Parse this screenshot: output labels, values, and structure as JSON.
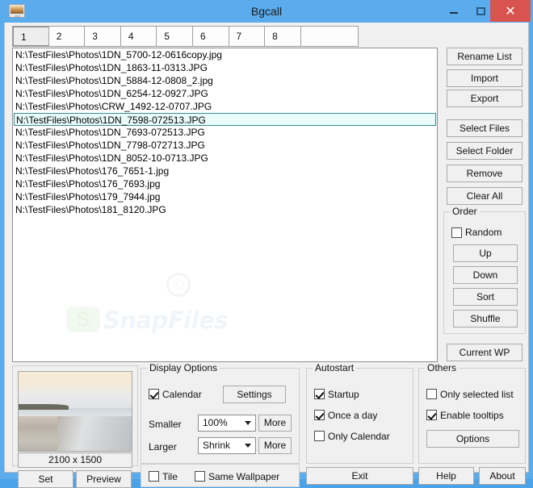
{
  "window": {
    "title": "Bgcall",
    "icon": "monitor-wallpaper-icon",
    "minimize_label": "—",
    "maximize_label": "□",
    "close_label": "✕"
  },
  "tabs": {
    "items": [
      "1",
      "2",
      "3",
      "4",
      "5",
      "6",
      "7",
      "8"
    ],
    "selected_index": 0
  },
  "file_list": {
    "items": [
      {
        "path": "N:\\TestFiles\\Photos\\1DN_5700-12-0616copy.jpg",
        "selected": false
      },
      {
        "path": "N:\\TestFiles\\Photos\\1DN_1863-11-0313.JPG",
        "selected": false
      },
      {
        "path": "N:\\TestFiles\\Photos\\1DN_5884-12-0808_2.jpg",
        "selected": false
      },
      {
        "path": "N:\\TestFiles\\Photos\\1DN_6254-12-0927.JPG",
        "selected": false
      },
      {
        "path": "N:\\TestFiles\\Photos\\CRW_1492-12-0707.JPG",
        "selected": false
      },
      {
        "path": "N:\\TestFiles\\Photos\\1DN_7598-072513.JPG",
        "selected": true
      },
      {
        "path": "N:\\TestFiles\\Photos\\1DN_7693-072513.JPG",
        "selected": false
      },
      {
        "path": "N:\\TestFiles\\Photos\\1DN_7798-072713.JPG",
        "selected": false
      },
      {
        "path": "N:\\TestFiles\\Photos\\1DN_8052-10-0713.JPG",
        "selected": false
      },
      {
        "path": "N:\\TestFiles\\Photos\\176_7651-1.jpg",
        "selected": false
      },
      {
        "path": "N:\\TestFiles\\Photos\\176_7693.jpg",
        "selected": false
      },
      {
        "path": "N:\\TestFiles\\Photos\\179_7944.jpg",
        "selected": false
      },
      {
        "path": "N:\\TestFiles\\Photos\\181_8120.JPG",
        "selected": false
      }
    ],
    "watermark": {
      "copyright": "©",
      "mark": "S",
      "text": "SnapFiles"
    }
  },
  "right_buttons": {
    "rename_list": "Rename List",
    "import": "Import",
    "export": "Export",
    "select_files": "Select Files",
    "select_folder": "Select Folder",
    "remove": "Remove",
    "clear_all": "Clear All",
    "current_wp": "Current WP"
  },
  "order_group": {
    "label": "Order",
    "random": {
      "label": "Random",
      "checked": false
    },
    "up": "Up",
    "down": "Down",
    "sort": "Sort",
    "shuffle": "Shuffle"
  },
  "preview": {
    "dimensions": "2100 x 1500",
    "set_label": "Set",
    "preview_label": "Preview"
  },
  "display_options": {
    "label": "Display Options",
    "calendar": {
      "label": "Calendar",
      "checked": true
    },
    "settings_label": "Settings",
    "smaller_label": "Smaller",
    "smaller_value": "100%",
    "smaller_more": "More",
    "larger_label": "Larger",
    "larger_value": "Shrink",
    "larger_more": "More",
    "tile": {
      "label": "Tile",
      "checked": false
    },
    "same_wallpaper": {
      "label": "Same Wallpaper",
      "checked": false
    }
  },
  "autostart": {
    "label": "Autostart",
    "startup": {
      "label": "Startup",
      "checked": true
    },
    "once_a_day": {
      "label": "Once a day",
      "checked": true
    },
    "only_calendar": {
      "label": "Only Calendar",
      "checked": false
    }
  },
  "others": {
    "label": "Others",
    "only_selected_list": {
      "label": "Only selected list",
      "checked": false
    },
    "enable_tooltips": {
      "label": "Enable tooltips",
      "checked": true
    },
    "options_label": "Options"
  },
  "bottom_buttons": {
    "exit": "Exit",
    "help": "Help",
    "about": "About"
  },
  "colors": {
    "titlebar": "#5aaced",
    "close_button": "#d9534f",
    "client": "#f0f0f0",
    "list_background": "#ffffff",
    "selection": "#e9fbfb",
    "selection_border": "#3a8e8e"
  }
}
